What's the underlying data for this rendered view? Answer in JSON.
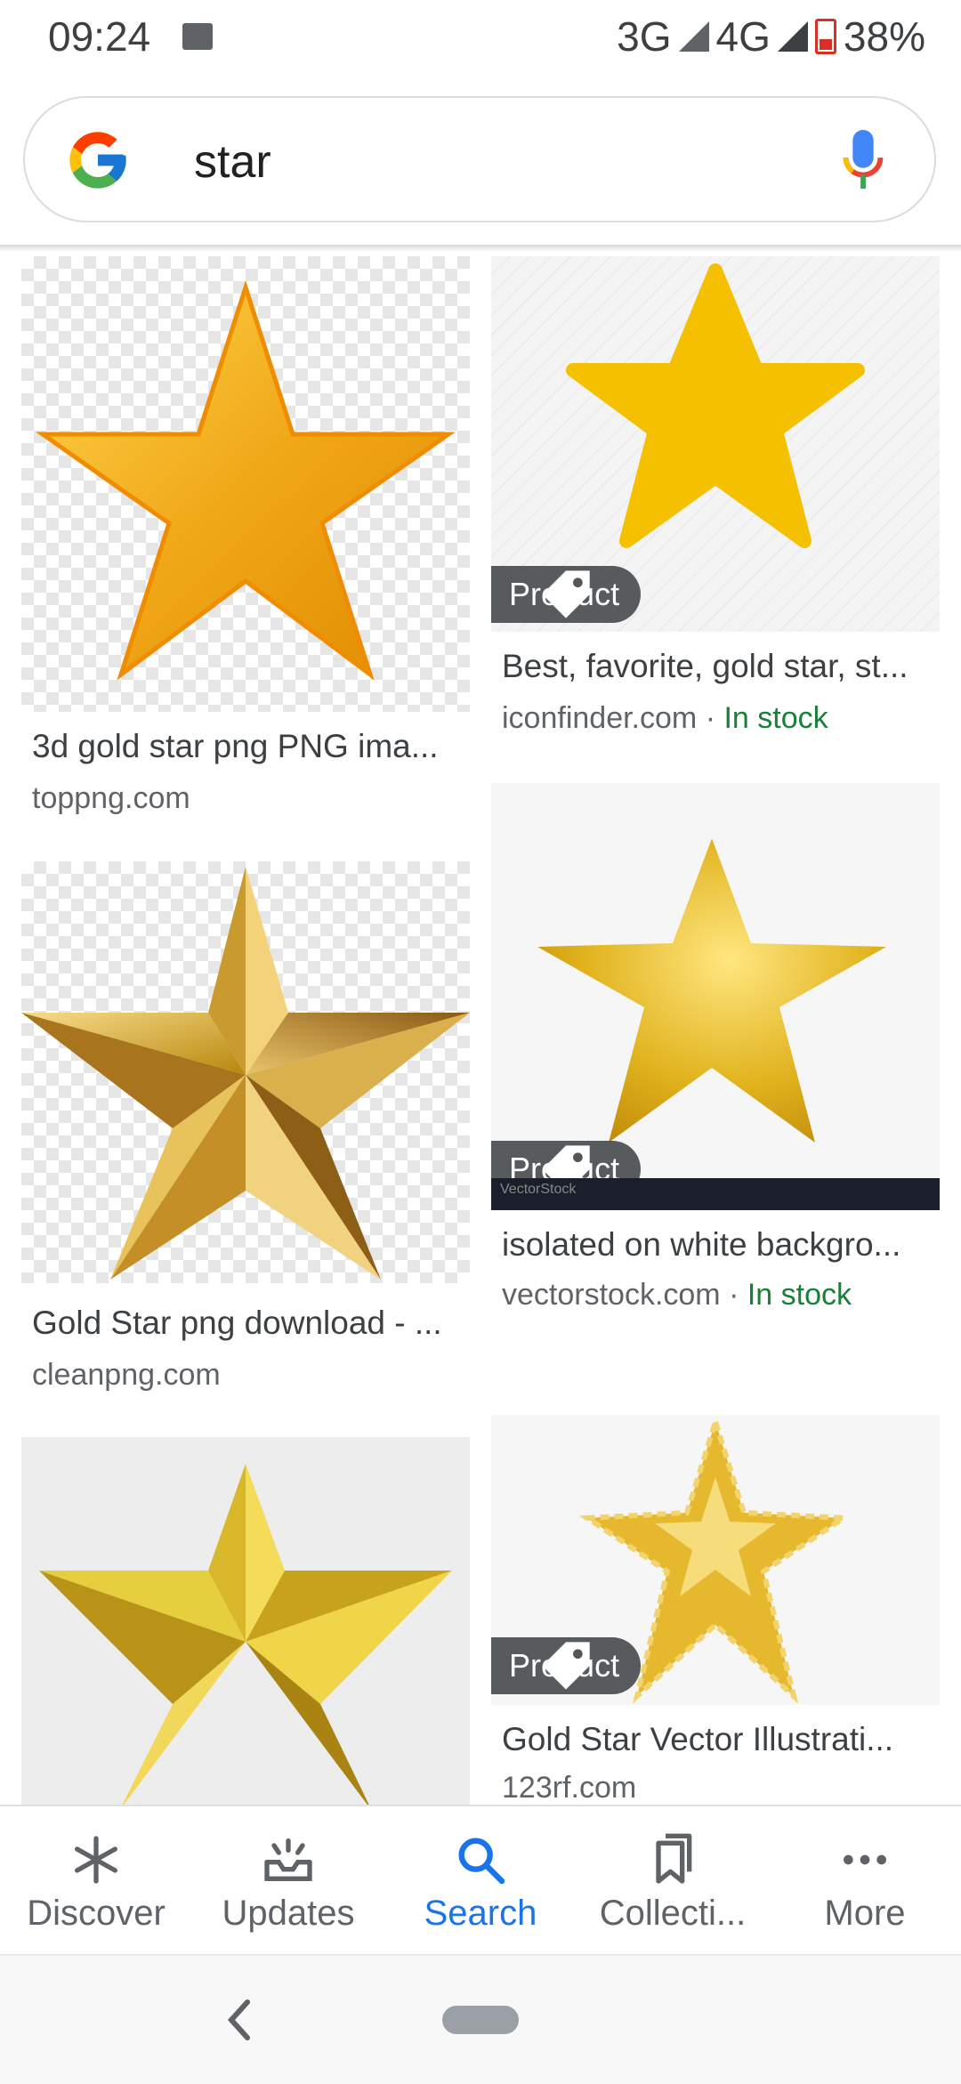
{
  "status_bar": {
    "time": "09:24",
    "network": "3G",
    "network_sup": "3G",
    "network2": "4G",
    "battery": "38%",
    "icons": [
      "image-notification-icon",
      "signal-icon",
      "battery-icon"
    ]
  },
  "search": {
    "query": "star",
    "icons": [
      "google-logo",
      "microphone-icon"
    ]
  },
  "results": [
    {
      "title": "3d gold star png PNG ima...",
      "source": "toppng.com",
      "stock": "",
      "badge": ""
    },
    {
      "title": "Best, favorite, gold star, st...",
      "source": "iconfinder.com",
      "separator": "·",
      "stock": "In stock",
      "badge": "Product"
    },
    {
      "title": "Gold Star png download - ...",
      "source": "cleanpng.com",
      "stock": "",
      "badge": ""
    },
    {
      "title": "isolated on white backgro...",
      "source": "vectorstock.com",
      "separator": "·",
      "stock": "In stock",
      "badge": "Product",
      "watermark": "VectorStock"
    },
    {
      "title": "",
      "source": "",
      "stock": "",
      "badge": ""
    },
    {
      "title": "Gold Star Vector Illustrati...",
      "source": "123rf.com",
      "stock": "",
      "badge": "Product"
    }
  ],
  "bottom_nav": {
    "items": [
      {
        "label": "Discover",
        "icon": "asterisk-icon",
        "active": false
      },
      {
        "label": "Updates",
        "icon": "updates-tray-icon",
        "active": false
      },
      {
        "label": "Search",
        "icon": "search-icon",
        "active": true
      },
      {
        "label": "Collecti...",
        "icon": "bookmarks-icon",
        "active": false
      },
      {
        "label": "More",
        "icon": "more-dots-icon",
        "active": false
      }
    ]
  },
  "colors": {
    "active": "#1a73e8",
    "in_stock": "#188038",
    "gold": "#f5b000"
  }
}
